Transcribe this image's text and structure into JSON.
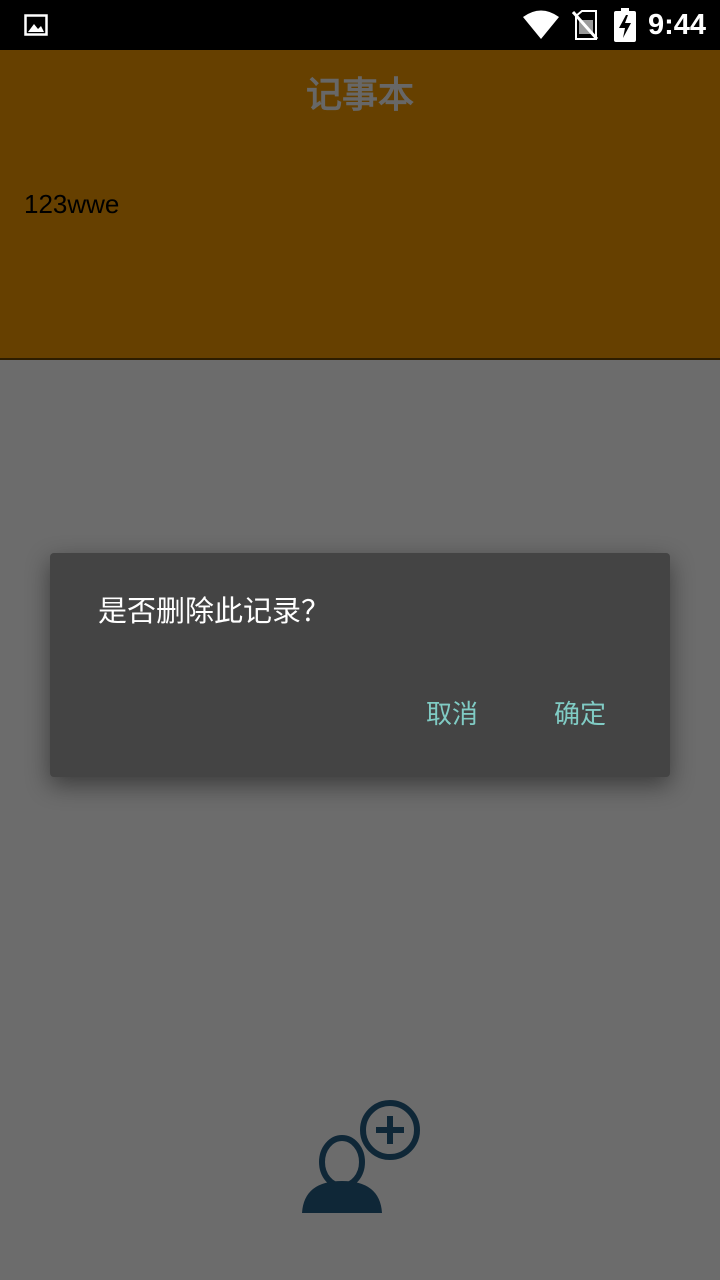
{
  "status_bar": {
    "time": "9:44",
    "icons": [
      "gallery-icon",
      "wifi-icon",
      "no-sim-icon",
      "battery-charging-icon"
    ]
  },
  "header": {
    "title": "记事本",
    "background_color": "#cc8000",
    "title_color": "#cfcfcf"
  },
  "notes": [
    {
      "text": "123wwe"
    }
  ],
  "fab": {
    "icon": "add-user-icon",
    "color": "#1f4e6e"
  },
  "dialog": {
    "message": "是否删除此记录？",
    "cancel_label": "取消",
    "confirm_label": "确定",
    "background_color": "#444444",
    "button_color": "#80cbc4"
  }
}
